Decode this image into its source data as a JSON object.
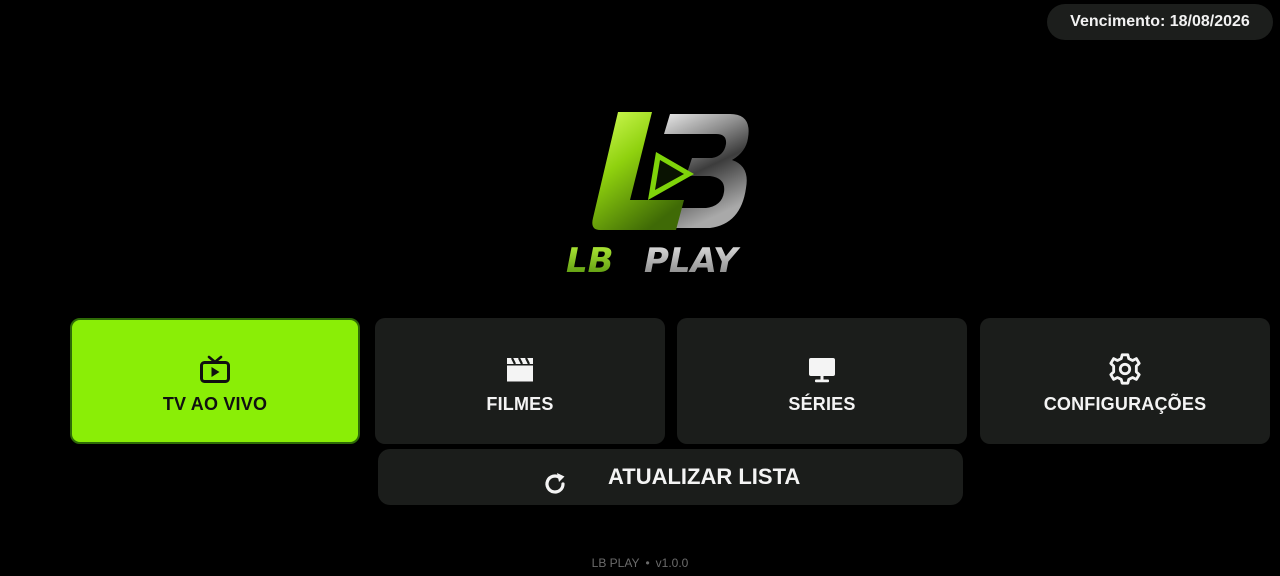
{
  "status": {
    "expiry_text": "Vencimento: 18/08/2026"
  },
  "logo": {
    "text_lb": "LB",
    "text_play": "PLAY",
    "brand_green": "#8aee06"
  },
  "menu": {
    "items": [
      {
        "label": "TV AO VIVO",
        "icon": "tv-icon",
        "selected": true
      },
      {
        "label": "FILMES",
        "icon": "clapperboard-icon",
        "selected": false
      },
      {
        "label": "SÉRIES",
        "icon": "monitor-icon",
        "selected": false
      },
      {
        "label": "CONFIGURAÇÕES",
        "icon": "gear-icon",
        "selected": false
      }
    ]
  },
  "refresh": {
    "label": "ATUALIZAR LISTA",
    "icon": "refresh-icon"
  },
  "footer": {
    "app_name": "LB PLAY",
    "separator": "•",
    "version": "v1.0.0"
  },
  "colors": {
    "background": "#000000",
    "card": "#1b1d1b",
    "accent": "#8aee06"
  }
}
